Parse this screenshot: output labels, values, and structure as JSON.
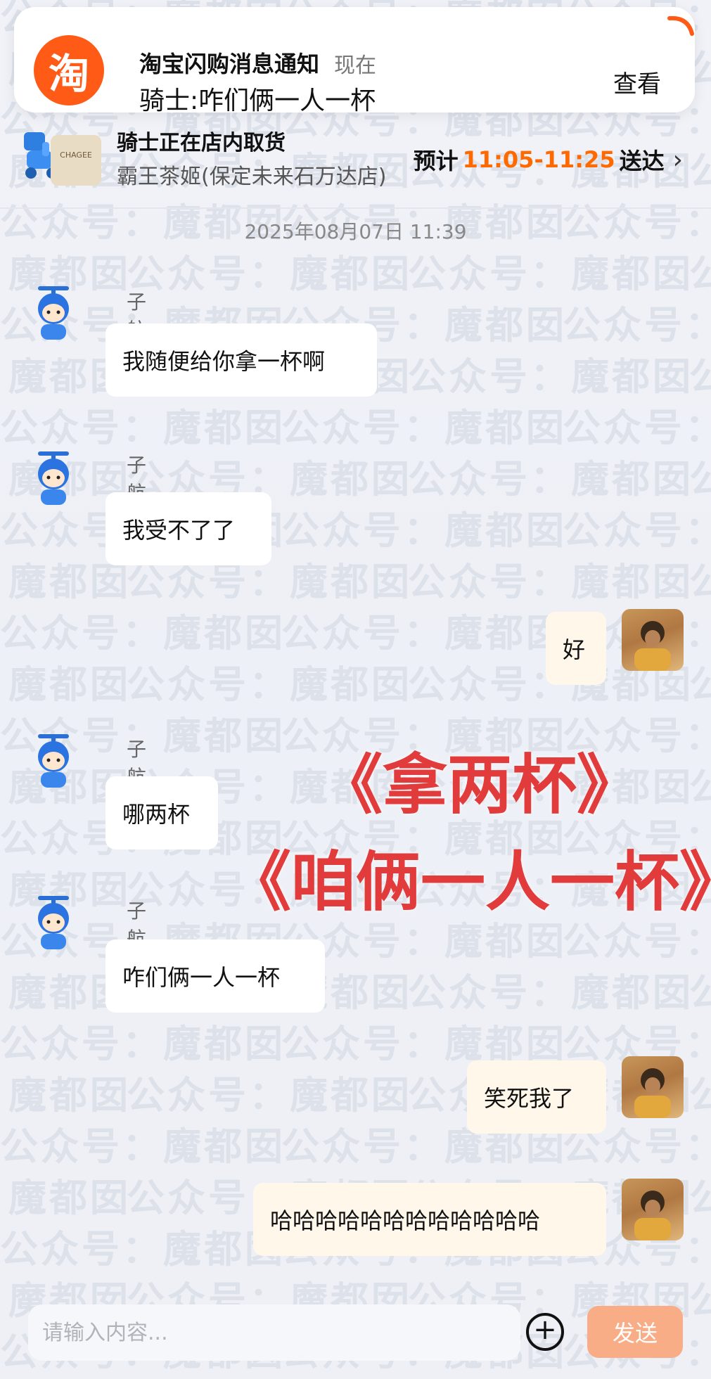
{
  "notification": {
    "app_logo_text": "淘",
    "title": "淘宝闪购消息通知",
    "time": "现在",
    "body": "骑士:咋们俩一人一杯",
    "view_label": "查看",
    "logo_color": "#ff5a16"
  },
  "order": {
    "store_thumb_text": "CHAGEE",
    "status": "骑士正在店内取货",
    "store": "霸王茶姬(保定未来石万达店)",
    "eta_prefix": "预计",
    "eta_time": "11:05-11:25",
    "eta_suffix": "送达",
    "eta_color": "#ff6a00"
  },
  "timestamp": "2025年08月07日 11:39",
  "messages": [
    {
      "sender": "子航",
      "text": "我随便给你拿一杯啊",
      "from": "rider"
    },
    {
      "sender": "子航",
      "text": "我受不了了",
      "from": "rider"
    },
    {
      "text": "好",
      "from": "me"
    },
    {
      "sender": "子航",
      "text": "哪两杯",
      "from": "rider"
    },
    {
      "sender": "子航",
      "text": "咋们俩一人一杯",
      "from": "rider"
    },
    {
      "text": "笑死我了",
      "from": "me"
    },
    {
      "text": "哈哈哈哈哈哈哈哈哈哈哈哈",
      "from": "me"
    }
  ],
  "overlay": {
    "line1": "《拿两杯》",
    "line2": "《咱俩一人一杯》",
    "color": "#e23b3b"
  },
  "watermark": "公众号：魔都囡",
  "input": {
    "placeholder": "请输入内容...",
    "send_label": "发送",
    "send_color": "#f9ad86"
  }
}
